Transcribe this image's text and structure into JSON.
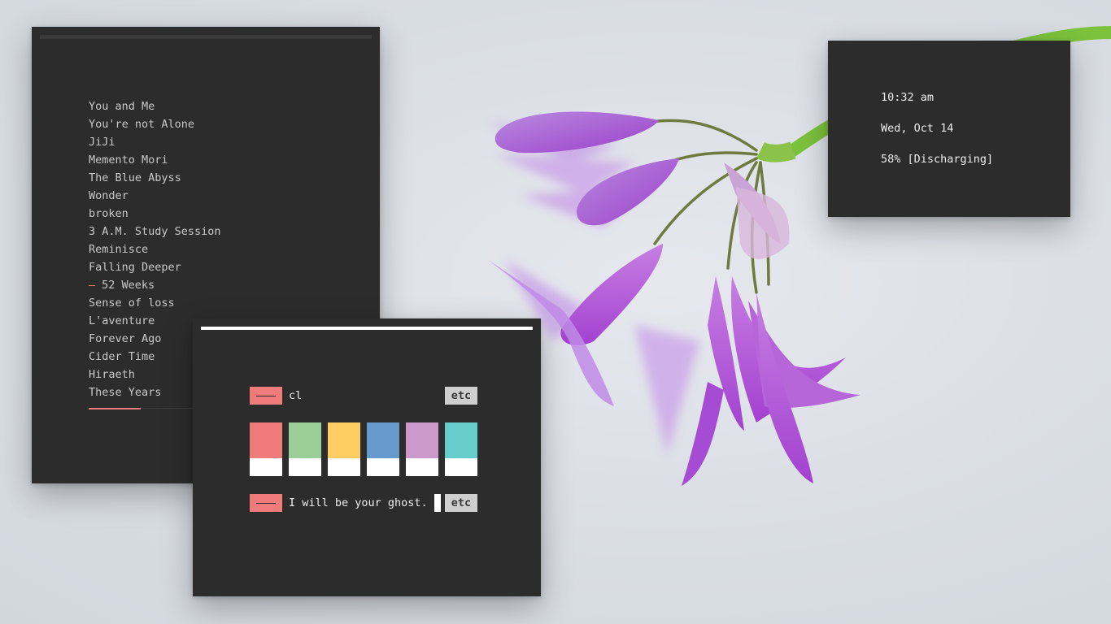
{
  "playlist": {
    "tracks": [
      "You and Me",
      "You're not Alone",
      "JiJi",
      "Memento Mori",
      "The Blue Abyss",
      "Wonder",
      "broken",
      "3 A.M. Study Session",
      "Reminisce",
      "Falling Deeper",
      "52 Weeks",
      "Sense of loss",
      "L'aventure",
      "Forever Ago",
      "Cider Time",
      "Hiraeth",
      "These Years"
    ],
    "current_marker": "–",
    "current_index": 10,
    "progress_fraction": 0.46
  },
  "status": {
    "time": "10:32 am",
    "date": "Wed, Oct 14",
    "battery": "58% [Discharging]"
  },
  "terminal": {
    "prompt1_command": "cl",
    "prompt2_command": "I will be your ghost.",
    "etc_label": "etc",
    "palette": [
      "#f07b7b",
      "#9ccf98",
      "#fdcd63",
      "#6699cc",
      "#cc99cc",
      "#66cccc"
    ],
    "accent": "#f07b7b"
  },
  "icons": {
    "wallpaper": "purple-flower-image"
  }
}
